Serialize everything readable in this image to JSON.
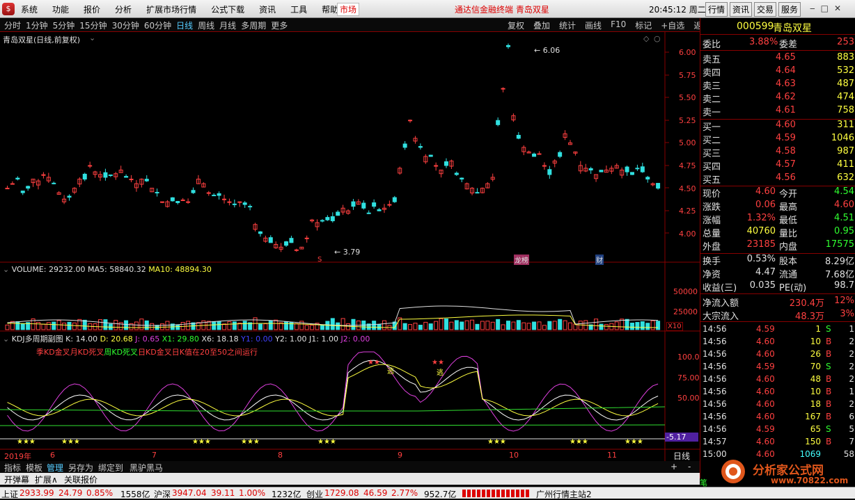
{
  "menu": {
    "items": [
      "系统",
      "功能",
      "报价",
      "分析",
      "扩展市场行情",
      "公式下载",
      "资讯",
      "工具",
      "帮助"
    ],
    "market": "市场",
    "title": "通达信金融终端  青岛双星",
    "clock": "20:45:12 周二",
    "right_buttons": [
      "行情",
      "资讯",
      "交易",
      "服务"
    ]
  },
  "periods": [
    "分时",
    "1分钟",
    "5分钟",
    "15分钟",
    "30分钟",
    "60分钟",
    "日线",
    "周线",
    "月线",
    "多周期",
    "更多"
  ],
  "active_period": "日线",
  "tools": [
    "复权",
    "叠加",
    "统计",
    "画线",
    "F10",
    "标记",
    "+自选",
    "返回"
  ],
  "main": {
    "title": "青岛双星(日线,前复权)",
    "high_mark": "6.06",
    "low_mark": "3.79",
    "badge_s": "S",
    "badge_lhb": "龙榜",
    "badge_cai": "财",
    "price_ticks": [
      "6.00",
      "5.75",
      "5.50",
      "5.25",
      "5.00",
      "4.75",
      "4.50",
      "4.25",
      "4.00"
    ]
  },
  "volume": {
    "title": "VOLUME: 29232.00",
    "ma5": "MA5: 58840.32",
    "ma10": "MA10: 48894.30",
    "ticks": [
      "50000",
      "25000"
    ],
    "unit": "X10"
  },
  "kdj": {
    "title": "KDJ多周期副图",
    "k": "K: 14.00",
    "d": "D: 20.68",
    "j": "J: 0.65",
    "x1": "X1: 29.80",
    "x6": "X6: 18.18",
    "y1": "Y1: 0.00",
    "y2": "Y2: 1.00",
    "j1": "J1: 1.00",
    "j2": "J2: 0.00",
    "legend": [
      "季KD金叉",
      "月KD死叉",
      "周KD死叉",
      "日KD金叉",
      "日K值在20至50之间运行"
    ],
    "ticks": [
      "100.0",
      "75.00",
      "50.00"
    ],
    "current": "-5.17",
    "flee": "逃"
  },
  "xaxis": {
    "labels": [
      "2019年",
      "6",
      "7",
      "8",
      "9",
      "10",
      "11"
    ],
    "period": "日线"
  },
  "tabs": [
    "指标",
    "模板",
    "管理",
    "另存为",
    "绑定到",
    "黑驴黑马"
  ],
  "tabs2": [
    "开弹幕",
    "扩展∧",
    "关联报价"
  ],
  "panel": {
    "code": "000599",
    "name": "青岛双星",
    "weibi_label": "委比",
    "weibi": "3.88%",
    "weicha_label": "委差",
    "weicha": "253",
    "asks": [
      {
        "label": "卖五",
        "price": "4.65",
        "vol": "883"
      },
      {
        "label": "卖四",
        "price": "4.64",
        "vol": "532"
      },
      {
        "label": "卖三",
        "price": "4.63",
        "vol": "487"
      },
      {
        "label": "卖二",
        "price": "4.62",
        "vol": "474"
      },
      {
        "label": "卖一",
        "price": "4.61",
        "vol": "758"
      }
    ],
    "bids": [
      {
        "label": "买一",
        "price": "4.60",
        "vol": "311"
      },
      {
        "label": "买二",
        "price": "4.59",
        "vol": "1046"
      },
      {
        "label": "买三",
        "price": "4.58",
        "vol": "987"
      },
      {
        "label": "买四",
        "price": "4.57",
        "vol": "411"
      },
      {
        "label": "买五",
        "price": "4.56",
        "vol": "632"
      }
    ],
    "stats": [
      {
        "l1": "现价",
        "v1": "4.60",
        "c1": "red",
        "l2": "今开",
        "v2": "4.54",
        "c2": "green"
      },
      {
        "l1": "涨跌",
        "v1": "0.06",
        "c1": "red",
        "l2": "最高",
        "v2": "4.60",
        "c2": "red"
      },
      {
        "l1": "涨幅",
        "v1": "1.32%",
        "c1": "red",
        "l2": "最低",
        "v2": "4.51",
        "c2": "green"
      },
      {
        "l1": "总量",
        "v1": "40760",
        "c1": "yel",
        "l2": "量比",
        "v2": "0.95",
        "c2": "green"
      },
      {
        "l1": "外盘",
        "v1": "23185",
        "c1": "red",
        "l2": "内盘",
        "v2": "17575",
        "c2": "green"
      }
    ],
    "stats2": [
      {
        "l1": "换手",
        "v1": "0.53%",
        "l2": "股本",
        "v2": "8.29亿"
      },
      {
        "l1": "净资",
        "v1": "4.47",
        "l2": "流通",
        "v2": "7.68亿"
      },
      {
        "l1": "收益(三)",
        "v1": "0.035",
        "l2": "PE(动)",
        "v2": "98.7"
      }
    ],
    "flow": [
      {
        "label": "净流入额",
        "value": "230.4万",
        "pct": "12%"
      },
      {
        "label": "大宗流入",
        "value": "48.3万",
        "pct": "3%"
      }
    ],
    "ticks": [
      {
        "t": "14:56",
        "p": "4.59",
        "v": "1",
        "s": "S",
        "n": "1"
      },
      {
        "t": "14:56",
        "p": "4.60",
        "v": "10",
        "s": "B",
        "n": "2"
      },
      {
        "t": "14:56",
        "p": "4.60",
        "v": "26",
        "s": "B",
        "n": "2"
      },
      {
        "t": "14:56",
        "p": "4.59",
        "v": "70",
        "s": "S",
        "n": "2"
      },
      {
        "t": "14:56",
        "p": "4.60",
        "v": "48",
        "s": "B",
        "n": "2"
      },
      {
        "t": "14:56",
        "p": "4.60",
        "v": "10",
        "s": "B",
        "n": "1"
      },
      {
        "t": "14:56",
        "p": "4.60",
        "v": "18",
        "s": "B",
        "n": "2"
      },
      {
        "t": "14:56",
        "p": "4.60",
        "v": "167",
        "s": "B",
        "n": "6"
      },
      {
        "t": "14:56",
        "p": "4.59",
        "v": "65",
        "s": "S",
        "n": "5"
      },
      {
        "t": "14:57",
        "p": "4.60",
        "v": "150",
        "s": "B",
        "n": "7"
      },
      {
        "t": "15:00",
        "p": "4.60",
        "v": "1069",
        "s": "",
        "n": "58"
      }
    ]
  },
  "status": {
    "sh_label": "上证",
    "sh": "2933.99",
    "sh_chg": "24.79",
    "sh_pct": "0.85%",
    "sh_amt": "1558亿",
    "sz_label": "沪深",
    "sz": "3947.04",
    "sz_chg": "39.11",
    "sz_pct": "1.00%",
    "sz_amt": "1232亿",
    "cy_label": "创业",
    "cy": "1729.08",
    "cy_chg": "46.59",
    "cy_pct": "2.77%",
    "cy_amt": "952.7亿",
    "server": "广州行情主站2"
  },
  "watermark": {
    "name": "分析家公式网",
    "url": "www.70822.com"
  },
  "colors": {
    "up": "#ff4040",
    "down": "#30e0e0",
    "k": "#ffffff",
    "d": "#ffff40",
    "j": "#e040e0",
    "green_line": "#30e030",
    "accent_border": "#880000"
  }
}
